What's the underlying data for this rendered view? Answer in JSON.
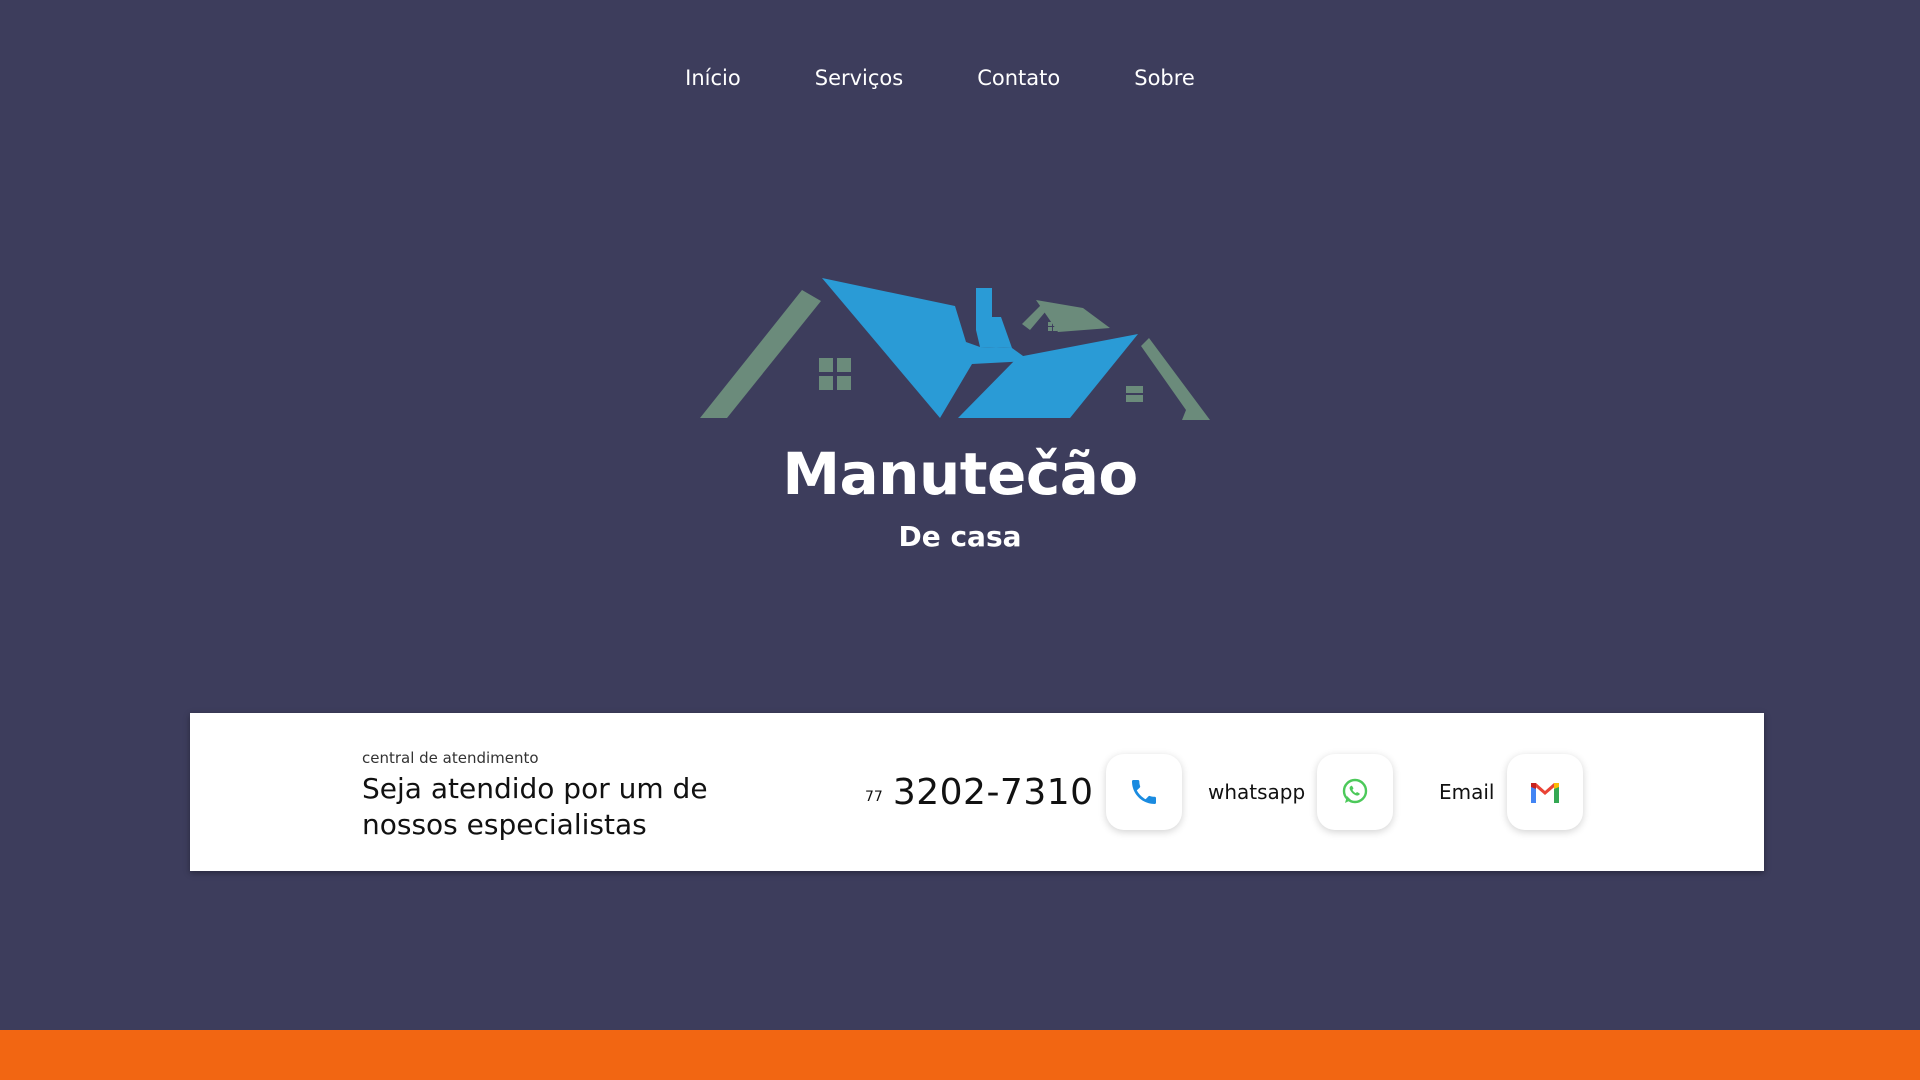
{
  "nav": {
    "items": [
      {
        "label": "Início"
      },
      {
        "label": "Serviços"
      },
      {
        "label": "Contato"
      },
      {
        "label": "Sobre"
      }
    ]
  },
  "brand": {
    "title": "Manutečão",
    "subtitle": "De casa"
  },
  "contact": {
    "kicker": "central de atendimento",
    "headline": "Seja atendido por um de nossos especialistas",
    "phone_ddd": "77",
    "phone_number": "3202-7310",
    "whatsapp_label": "whatsapp",
    "email_label": "Email"
  },
  "icons": {
    "phone": "phone-icon",
    "whatsapp": "whatsapp-icon",
    "email": "gmail-icon",
    "logo": "house-roof-logo"
  },
  "colors": {
    "background": "#3d3d5c",
    "accent_blue": "#2a9bd6",
    "accent_green": "#6b8b7b",
    "footer_orange": "#f26612",
    "card": "#ffffff"
  }
}
